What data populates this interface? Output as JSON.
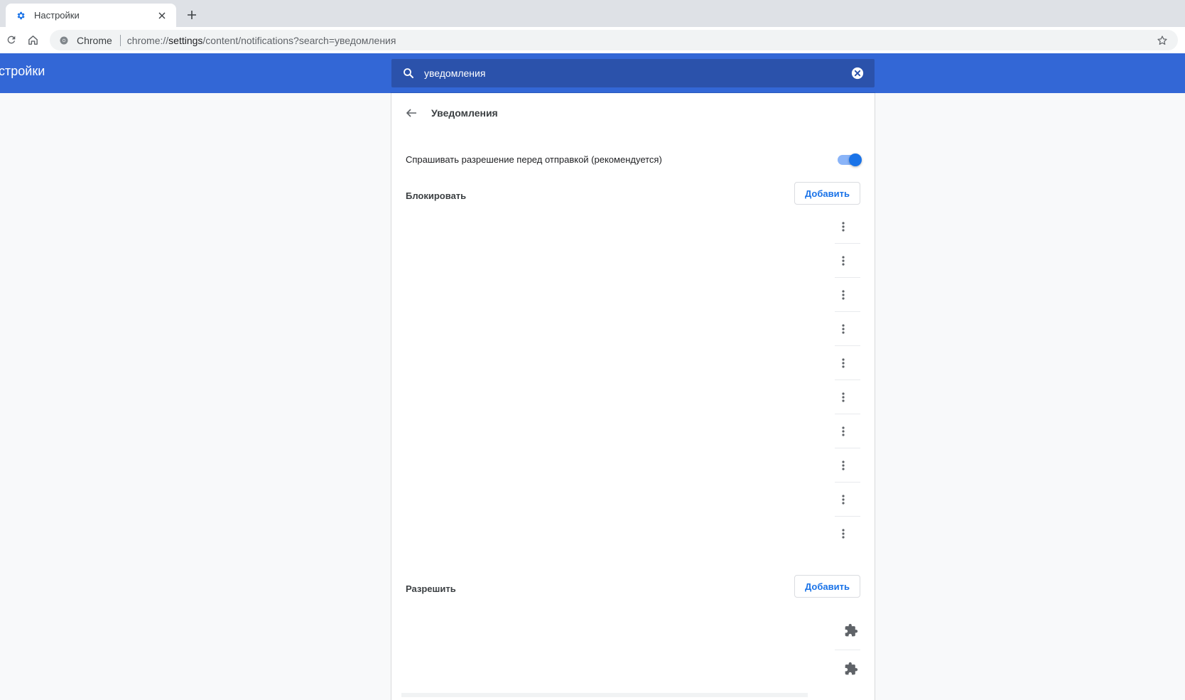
{
  "browser": {
    "tab": {
      "title": "Настройки",
      "favicon": "gear-icon"
    },
    "new_tab_icon": "plus-icon",
    "omnibox": {
      "site_chip": "Chrome",
      "url_scheme": "chrome://",
      "url_host": "settings",
      "url_path": "/content/notifications?search=уведомления"
    }
  },
  "settings": {
    "app_title": "астройки",
    "search": {
      "value": "уведомления"
    },
    "subpage": {
      "title": "Уведомления",
      "ask_toggle": {
        "label": "Спрашивать разрешение перед отправкой (рекомендуется)",
        "on": true
      },
      "block": {
        "label": "Блокировать",
        "add_label": "Добавить",
        "entries": 10
      },
      "allow": {
        "label": "Разрешить",
        "add_label": "Добавить",
        "entries": 2
      }
    }
  },
  "colors": {
    "accent": "#1a73e8",
    "header": "#3367d6",
    "search_bg": "#2b52ab"
  }
}
